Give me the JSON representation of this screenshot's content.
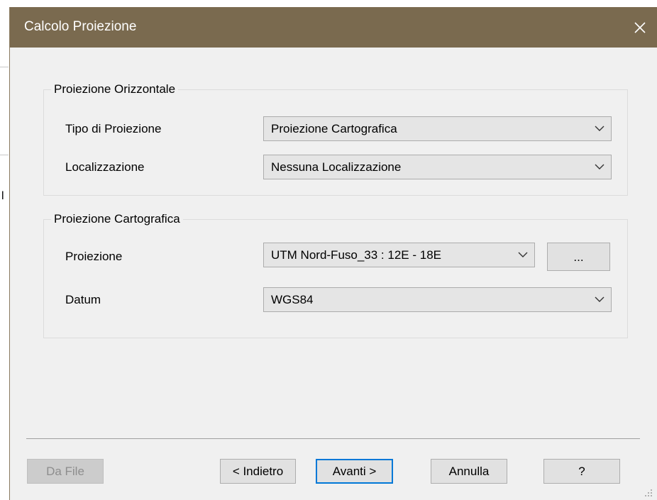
{
  "background": {
    "partial_char": "l"
  },
  "dialog": {
    "title": "Calcolo Proiezione",
    "close_icon": "close-icon",
    "titlebar_color": "#7a6a4f"
  },
  "horizontal_group": {
    "legend": "Proiezione Orizzontale",
    "projection_type": {
      "label": "Tipo di Proiezione",
      "value": "Proiezione Cartografica"
    },
    "localization": {
      "label": "Localizzazione",
      "value": "Nessuna Localizzazione"
    }
  },
  "cartographic_group": {
    "legend": "Proiezione Cartografica",
    "projection": {
      "label": "Proiezione",
      "value": "UTM Nord-Fuso_33 : 12E - 18E",
      "browse_label": "..."
    },
    "datum": {
      "label": "Datum",
      "value": "WGS84"
    }
  },
  "footer": {
    "from_file": "Da File",
    "back": "< Indietro",
    "next": "Avanti >",
    "cancel": "Annulla",
    "help": "?"
  },
  "colors": {
    "default_button_border": "#0078d7",
    "disabled_text": "#8d8d8d"
  }
}
